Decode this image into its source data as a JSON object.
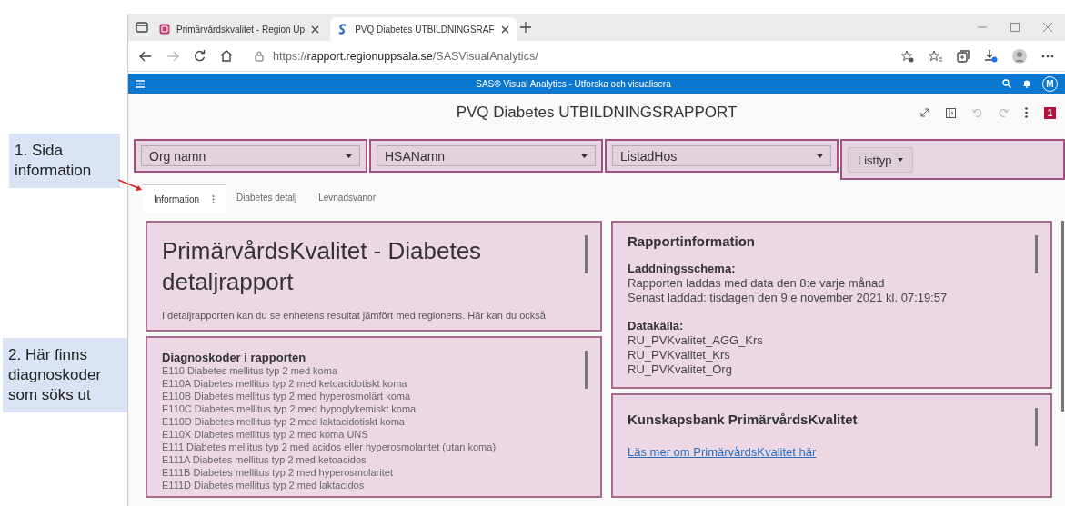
{
  "annotations": [
    {
      "text": "1. Sida information"
    },
    {
      "text": "2. Här finns diagnoskoder som söks ut"
    }
  ],
  "browser": {
    "tabs": [
      {
        "title": "Primärvårdskvalitet - Region Up",
        "selected": false
      },
      {
        "title": "PVQ Diabetes UTBILDNINGSRAF",
        "selected": true
      }
    ],
    "url": "https://**rapport.regionuppsala.se**/SASVisualAnalytics/"
  },
  "app_bar": {
    "title": "SAS® Visual Analytics - Utforska och visualisera",
    "avatar": "M"
  },
  "report": {
    "title": "PVQ Diabetes UTBILDNINGSRAPPORT",
    "notification_count": "1",
    "filters": [
      {
        "kind": "dropdown",
        "label": "Org namn"
      },
      {
        "kind": "dropdown",
        "label": "HSANamn"
      },
      {
        "kind": "dropdown",
        "label": "ListadHos"
      },
      {
        "kind": "button",
        "label": "Listtyp"
      }
    ],
    "tabs": [
      {
        "label": "Information",
        "selected": true
      },
      {
        "label": "Diabetes detalj",
        "selected": false
      },
      {
        "label": "Levnadsvanor",
        "selected": false
      }
    ],
    "columns": [
      {
        "panels": [
          {
            "kind": "intro",
            "title": "PrimärvårdsKvalitet - Diabetes detaljrapport",
            "text": "I detaljrapporten kan du se enhetens resultat jämfört med regionens. Här kan du också"
          },
          {
            "kind": "list",
            "title": "Diagnoskoder i rapporten",
            "items": [
              "E110 Diabetes mellitus typ 2 med koma",
              "E110A Diabetes mellitus typ 2 med ketoacidotiskt koma",
              "E110B Diabetes mellitus typ 2 med hyperosmolärt koma",
              "E110C Diabetes mellitus typ 2 med hypoglykemiskt koma",
              "E110D Diabetes mellitus typ 2 med laktacidotiskt koma",
              "E110X Diabetes mellitus typ 2 med koma UNS",
              "E111 Diabetes mellitus typ 2 med acidos eller hyperosmolaritet (utan koma)",
              "E111A Diabetes mellitus typ 2 med ketoacidos",
              "E111B Diabetes mellitus typ 2 med hyperosmolaritet",
              "E111D Diabetes mellitus typ 2 med laktacidos"
            ]
          }
        ]
      },
      {
        "panels": [
          {
            "kind": "info",
            "title": "Rapportinformation",
            "sections": [
              {
                "heading": "Laddningsschema:",
                "lines": [
                  "Rapporten laddas med data den 8:e varje månad",
                  "Senast laddad: tisdagen den 9:e november 2021 kl. 07:19:57"
                ]
              },
              {
                "heading": "Datakälla:",
                "lines": [
                  "RU_PVKvalitet_AGG_Krs",
                  "RU_PVKvalitet_Krs",
                  "RU_PVKvalitet_Org"
                ]
              }
            ]
          },
          {
            "kind": "link",
            "title": "Kunskapsbank PrimärvårdsKvalitet",
            "link": "Läs mer om PrimärvårdsKvalitet här"
          }
        ]
      }
    ]
  }
}
